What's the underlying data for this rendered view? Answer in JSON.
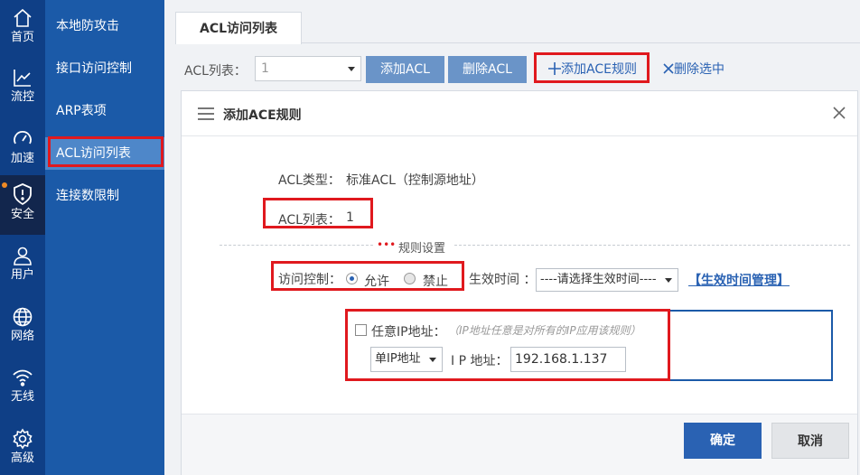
{
  "nav": {
    "items": [
      {
        "label": "首页",
        "icon": "home-icon"
      },
      {
        "label": "流控",
        "icon": "chart-line-icon"
      },
      {
        "label": "加速",
        "icon": "speedometer-icon"
      },
      {
        "label": "安全",
        "icon": "shield-icon"
      },
      {
        "label": "用户",
        "icon": "user-icon"
      },
      {
        "label": "网络",
        "icon": "globe-icon"
      },
      {
        "label": "无线",
        "icon": "wifi-icon"
      },
      {
        "label": "高级",
        "icon": "gear-icon"
      }
    ],
    "active_index": 3
  },
  "subnav": {
    "items": [
      {
        "label": "本地防攻击"
      },
      {
        "label": "接口访问控制"
      },
      {
        "label": "ARP表项"
      },
      {
        "label": "ACL访问列表"
      },
      {
        "label": "连接数限制"
      }
    ],
    "active_index": 3
  },
  "tab": {
    "label": "ACL访问列表"
  },
  "toolbar": {
    "acl_label": "ACL列表：",
    "acl_value": "1",
    "add_acl": "添加ACL",
    "delete_acl": "删除ACL",
    "add_ace_rule": "添加ACE规则",
    "delete_selected": "删除选中"
  },
  "dialog": {
    "title": "添加ACE规则",
    "acl_type_label": "ACL类型：",
    "acl_type_value": "标准ACL（控制源地址）",
    "acl_list_label": "ACL列表：",
    "acl_list_value": "1",
    "section_title": "规则设置",
    "access_control_label": "访问控制：",
    "allow_label": "允许",
    "deny_label": "禁止",
    "access_selected": "allow",
    "effective_time_label": "生效时间 ：",
    "effective_time_value": "----请选择生效时间----",
    "time_manage_link": "【生效时间管理】",
    "any_ip_label": "任意IP地址：",
    "any_ip_hint": "（IP地址任意是对所有的IP应用该规则）",
    "ip_type_value": "单IP地址",
    "ip_address_label": "I P 地址：",
    "ip_address_value": "192.168.1.137",
    "ok_label": "确定",
    "cancel_label": "取消"
  },
  "colors": {
    "nav_bg": "#0f3f86",
    "nav_active": "#12264d",
    "subnav_bg": "#1b5aa8",
    "subnav_active": "#4e87c9",
    "primary": "#2a62b3",
    "highlight_red": "#e0191e"
  }
}
